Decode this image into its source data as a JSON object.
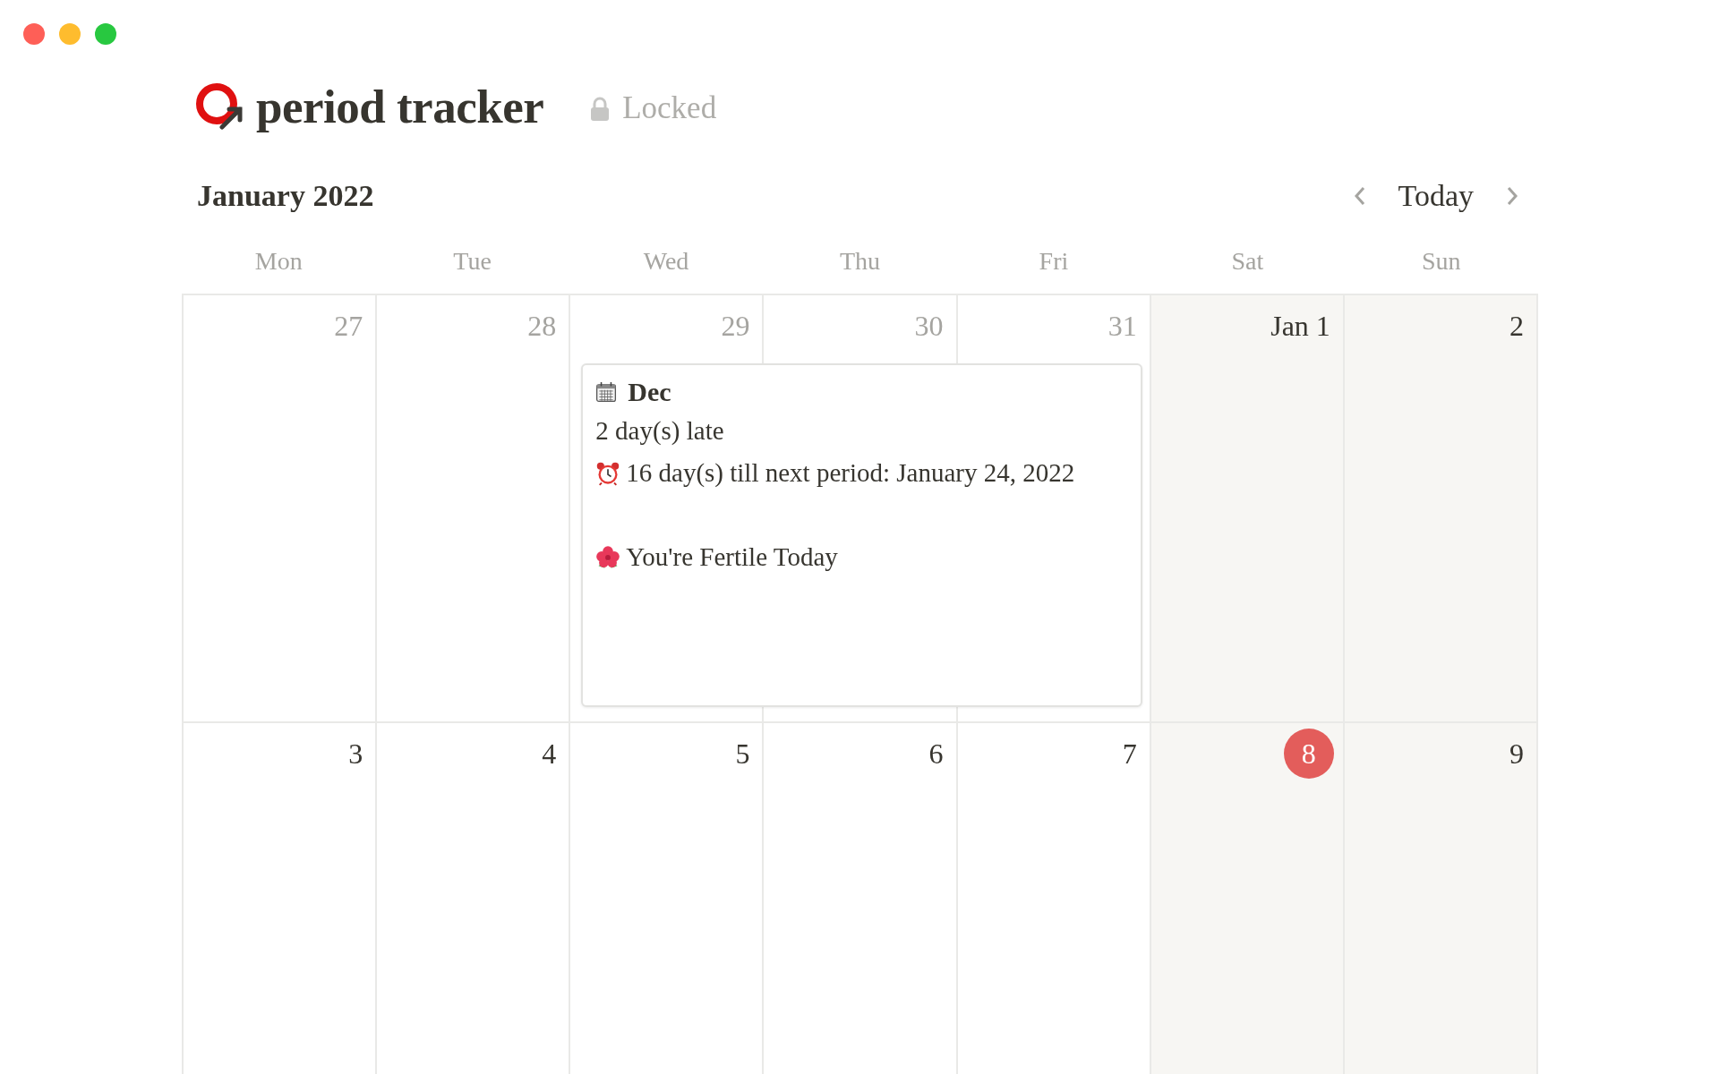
{
  "page": {
    "title": "period tracker",
    "lock_label": "Locked"
  },
  "calendar": {
    "month": "January 2022",
    "today_button": "Today",
    "weekdays": [
      "Mon",
      "Tue",
      "Wed",
      "Thu",
      "Fri",
      "Sat",
      "Sun"
    ],
    "weeks": [
      {
        "days": [
          {
            "label": "27",
            "muted": true,
            "today": false
          },
          {
            "label": "28",
            "muted": true,
            "today": false
          },
          {
            "label": "29",
            "muted": true,
            "today": false,
            "event": {
              "title": "Dec",
              "lines": [
                {
                  "kind": "plain",
                  "text": "2 day(s) late"
                },
                {
                  "kind": "alarm",
                  "text": "16 day(s) till next period: January 24, 2022"
                },
                {
                  "kind": "blank"
                },
                {
                  "kind": "flower",
                  "text": "You're Fertile Today"
                }
              ]
            }
          },
          {
            "label": "30",
            "muted": true,
            "today": false
          },
          {
            "label": "31",
            "muted": true,
            "today": false
          },
          {
            "label": "Jan 1",
            "muted": false,
            "today": false
          },
          {
            "label": "2",
            "muted": false,
            "today": false
          }
        ]
      },
      {
        "days": [
          {
            "label": "3",
            "muted": false,
            "today": false
          },
          {
            "label": "4",
            "muted": false,
            "today": false
          },
          {
            "label": "5",
            "muted": false,
            "today": false
          },
          {
            "label": "6",
            "muted": false,
            "today": false
          },
          {
            "label": "7",
            "muted": false,
            "today": false
          },
          {
            "label": "8",
            "muted": false,
            "today": true
          },
          {
            "label": "9",
            "muted": false,
            "today": false
          }
        ]
      }
    ]
  }
}
